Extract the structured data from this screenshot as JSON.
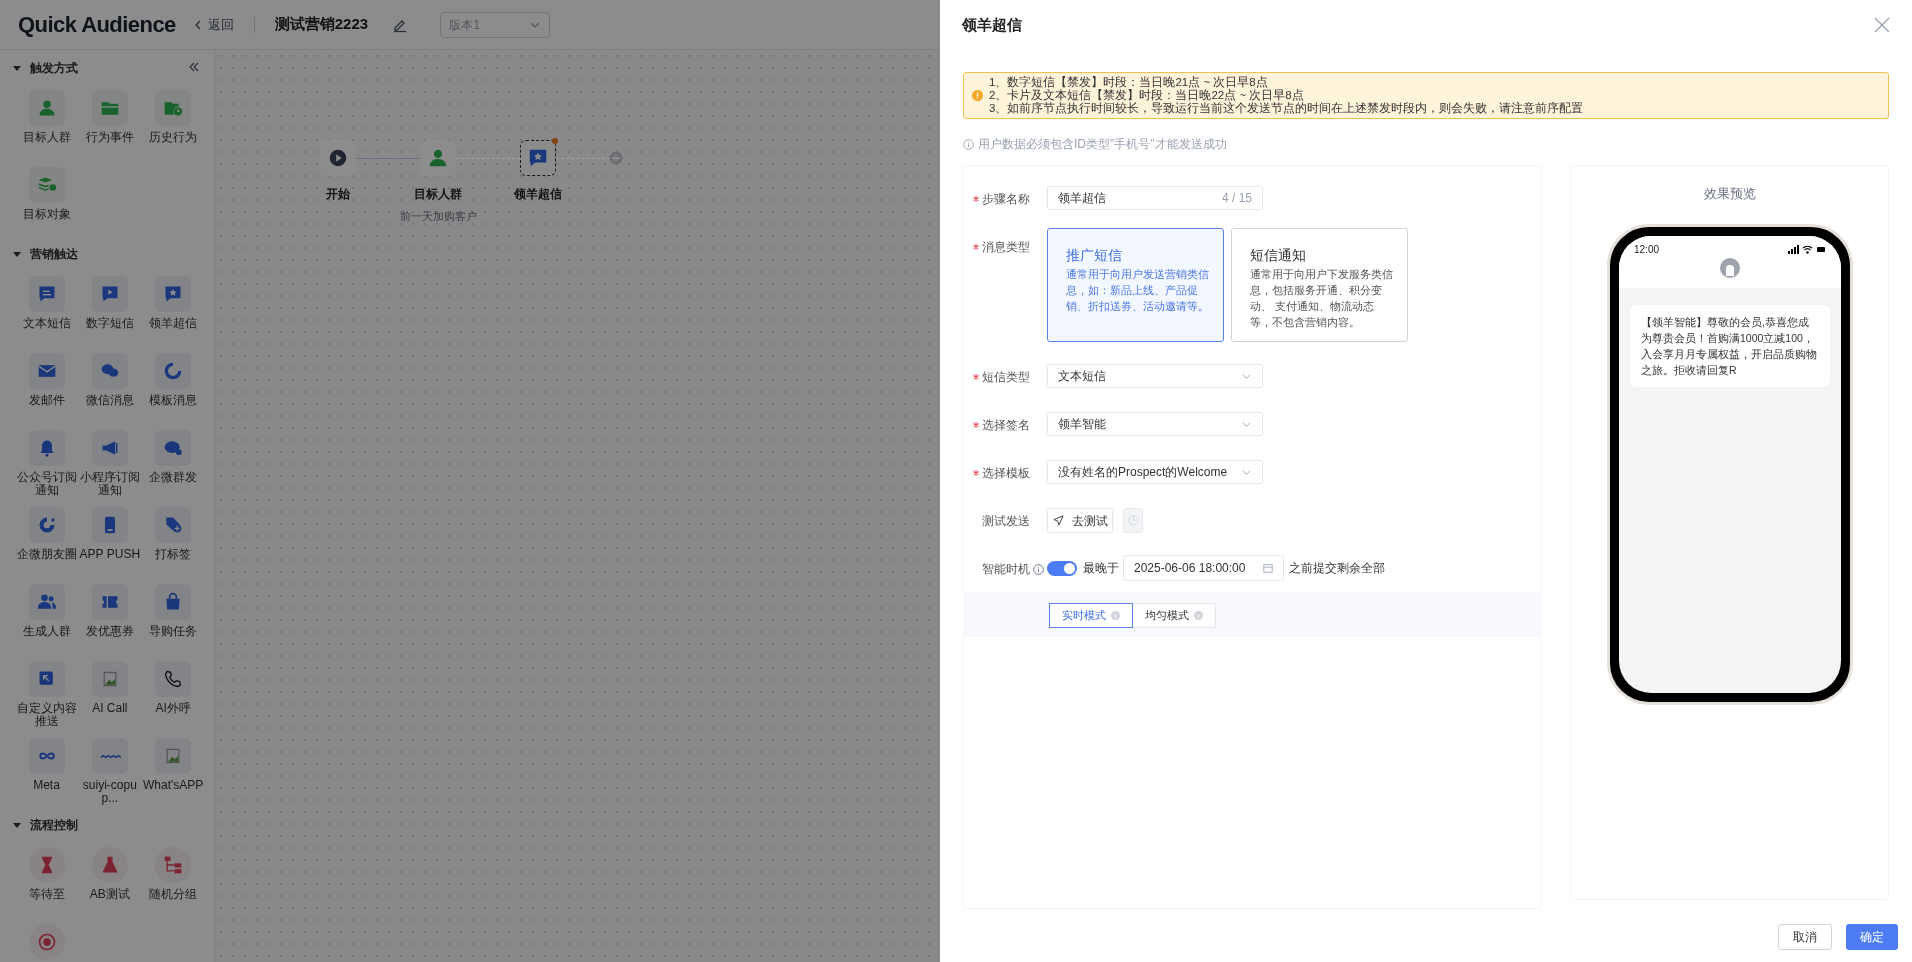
{
  "app": {
    "logo": "Quick Audience",
    "back": "返回",
    "flow_name": "测试营销2223",
    "version": "版本1"
  },
  "palette": {
    "sections": [
      {
        "title": "触发方式",
        "kind": "trigger",
        "expanded": true,
        "items": [
          {
            "label": "目标人群"
          },
          {
            "label": "行为事件"
          },
          {
            "label": "历史行为"
          },
          {
            "label": "目标对象"
          }
        ]
      },
      {
        "title": "营销触达",
        "kind": "touch",
        "expanded": true,
        "items": [
          {
            "label": "文本短信"
          },
          {
            "label": "数字短信"
          },
          {
            "label": "领羊超信"
          },
          {
            "label": "发邮件"
          },
          {
            "label": "微信消息"
          },
          {
            "label": "模板消息"
          },
          {
            "label": "公众号订阅通知"
          },
          {
            "label": "小程序订阅通知"
          },
          {
            "label": "企微群发"
          },
          {
            "label": "企微朋友圈"
          },
          {
            "label": "APP PUSH"
          },
          {
            "label": "打标签"
          },
          {
            "label": "生成人群"
          },
          {
            "label": "发优惠券"
          },
          {
            "label": "导购任务"
          },
          {
            "label": "自定义内容推送"
          },
          {
            "label": "AI Call"
          },
          {
            "label": "AI外呼"
          },
          {
            "label": "Meta"
          },
          {
            "label": "suiyi-copup..."
          },
          {
            "label": "What'sAPP"
          }
        ]
      },
      {
        "title": "流程控制",
        "kind": "control",
        "expanded": true,
        "items": [
          {
            "label": "等待至"
          },
          {
            "label": "AB测试"
          },
          {
            "label": "随机分组"
          }
        ]
      }
    ]
  },
  "canvas": {
    "nodes": [
      {
        "label": "开始",
        "kind": "start",
        "selected": false,
        "dashed_link": false
      },
      {
        "label": "目标人群",
        "sublabel": "前一天加购客户",
        "kind": "audience",
        "selected": false,
        "dashed_link": true
      },
      {
        "label": "领羊超信",
        "kind": "message",
        "selected": true,
        "dashed_link": true
      }
    ]
  },
  "drawer": {
    "title": "领羊超信",
    "alert": [
      "1、数字短信【禁发】时段：当日晚21点 ~ 次日早8点",
      "2、卡片及文本短信【禁发】时段：当日晚22点 ~ 次日早8点",
      "3、如前序节点执行时间较长，导致运行当前这个发送节点的时间在上述禁发时段内，则会失败，请注意前序配置"
    ],
    "note": "用户数据必须包含ID类型\"手机号\"才能发送成功",
    "form": [
      {
        "kind": "text",
        "label": "步骤名称",
        "required": true,
        "value": "领羊超信",
        "counter": "4 / 15"
      },
      {
        "kind": "cards",
        "label": "消息类型",
        "required": true,
        "options": [
          {
            "title": "推广短信",
            "description": "通常用于向用户发送营销类信息，如：新品上线、产品促销、折扣送券、活动邀请等。",
            "selected": true
          },
          {
            "title": "短信通知",
            "description": "通常用于向用户下发服务类信息，包括服务开通、积分变动、 支付通知、物流动态等，不包含营销内容。",
            "selected": false
          }
        ]
      },
      {
        "kind": "select",
        "label": "短信类型",
        "required": true,
        "value": "文本短信"
      },
      {
        "kind": "select",
        "label": "选择签名",
        "required": true,
        "value": "领羊智能"
      },
      {
        "kind": "select",
        "label": "选择模板",
        "required": true,
        "value": "没有姓名的Prospect的Welcome"
      },
      {
        "kind": "test",
        "label": "测试发送",
        "required": false,
        "button": "去测试"
      },
      {
        "kind": "timing",
        "label": "智能时机",
        "required": false,
        "on": true,
        "prefix": "最晚于",
        "datetime": "2025-06-06 18:00:00",
        "suffix": "之前提交剩余全部",
        "modes": [
          {
            "label": "实时模式",
            "selected": true
          },
          {
            "label": "均匀模式",
            "selected": false
          }
        ]
      }
    ],
    "preview": {
      "title": "效果预览",
      "time": "12:00",
      "message": "【领羊智能】尊敬的会员,恭喜您成为尊贵会员！首购满1000立减100，入会享月月专属权益，开启品质购物之旅。拒收请回复R"
    },
    "buttons": [
      {
        "label": "取消",
        "kind": "secondary"
      },
      {
        "label": "确定",
        "kind": "primary"
      }
    ]
  }
}
